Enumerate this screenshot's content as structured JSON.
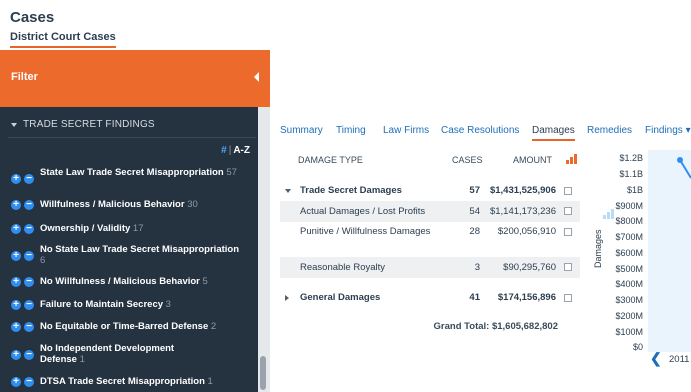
{
  "header": {
    "title": "Cases",
    "sub_tab": "District Court Cases"
  },
  "filter": {
    "label": "Filter"
  },
  "sidebar": {
    "section_title": "TRADE SECRET FINDINGS",
    "sort_hash": "#",
    "sort_sep": "|",
    "sort_az": "A-Z",
    "items": [
      {
        "name": "State Law Trade Secret Misappropriation",
        "count": "57"
      },
      {
        "name": "Willfulness / Malicious Behavior",
        "count": "30"
      },
      {
        "name": "Ownership / Validity",
        "count": "17"
      },
      {
        "name": "No State Law Trade Secret Misappropriation",
        "count": "6"
      },
      {
        "name": "No Willfulness / Malicious Behavior",
        "count": "5"
      },
      {
        "name": "Failure to Maintain Secrecy",
        "count": "3"
      },
      {
        "name": "No Equitable or Time-Barred Defense",
        "count": "2"
      },
      {
        "name": "No Independent Development Defense",
        "count": "1"
      },
      {
        "name": "DTSA Trade Secret Misappropriation",
        "count": "1"
      }
    ]
  },
  "tabs": [
    {
      "label": "Summary"
    },
    {
      "label": "Timing"
    },
    {
      "label": "Law Firms"
    },
    {
      "label": "Case Resolutions"
    },
    {
      "label": "Damages"
    },
    {
      "label": "Remedies"
    },
    {
      "label": "Findings ▾"
    }
  ],
  "damages_table": {
    "headers": {
      "type": "DAMAGE TYPE",
      "cases": "CASES",
      "amount": "AMOUNT"
    },
    "rows": [
      {
        "type": "Trade Secret Damages",
        "cases": "57",
        "amount": "$1,431,525,906"
      },
      {
        "type": "Actual Damages / Lost Profits",
        "cases": "54",
        "amount": "$1,141,173,236"
      },
      {
        "type": "Punitive / Willfulness Damages",
        "cases": "28",
        "amount": "$200,056,910"
      },
      {
        "type": "Reasonable Royalty",
        "cases": "3",
        "amount": "$90,295,760"
      },
      {
        "type": "General Damages",
        "cases": "41",
        "amount": "$174,156,896"
      }
    ],
    "grand_total": "Grand Total: $1,605,682,802"
  },
  "chart": {
    "ylabel": "Damages",
    "ticks": [
      "$1.2B",
      "$1.1B",
      "$1B",
      "$900M",
      "$800M",
      "$700M",
      "$600M",
      "$500M",
      "$400M",
      "$300M",
      "$200M",
      "$100M",
      "$0"
    ],
    "year": "2011",
    "prev_arrow": "❮"
  },
  "colors": {
    "accent": "#ec6a2c",
    "sidebar_bg": "#253240",
    "link": "#1f6fb8",
    "icon_blue": "#2f8ef0"
  }
}
